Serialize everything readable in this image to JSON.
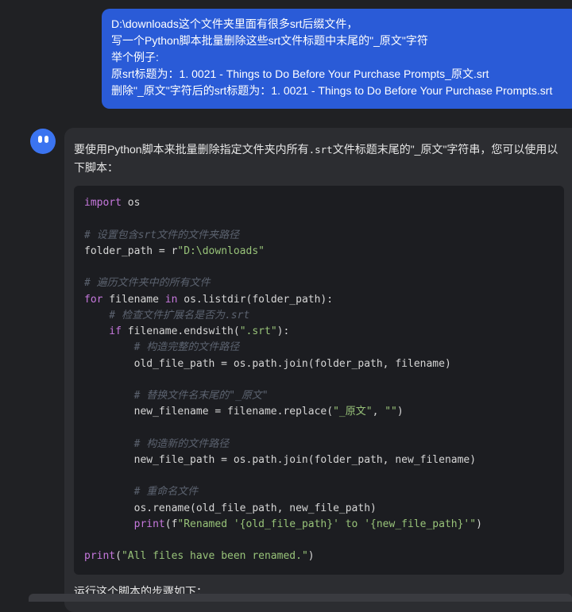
{
  "user_message": {
    "lines": [
      "D:\\downloads这个文件夹里面有很多srt后缀文件，",
      "写一个Python脚本批量删除这些srt文件标题中末尾的\"_原文\"字符",
      "举个例子:",
      "原srt标题为：1. 0021 - Things to Do Before Your Purchase Prompts_原文.srt",
      "删除\"_原文\"字符后的srt标题为：1. 0021 - Things to Do Before Your Purchase Prompts.srt"
    ]
  },
  "assistant": {
    "intro_before": "要使用Python脚本来批量删除指定文件夹内所有",
    "intro_code": ".srt",
    "intro_after": "文件标题末尾的\"_原文\"字符串，您可以使用以下脚本：",
    "code": {
      "l1_kw": "import",
      "l1_rest": " os",
      "c1": "# 设置包含srt文件的文件夹路径",
      "l2_a": "folder_path = r",
      "l2_str": "\"D:\\downloads\"",
      "c2": "# 遍历文件夹中的所有文件",
      "l3_kw1": "for",
      "l3_a": " filename ",
      "l3_kw2": "in",
      "l3_b": " os.listdir(folder_path):",
      "c3": "    # 检查文件扩展名是否为.srt",
      "l4_kw": "    if",
      "l4_a": " filename.endswith(",
      "l4_str": "\".srt\"",
      "l4_b": "):",
      "c4": "        # 构造完整的文件路径",
      "l5": "        old_file_path = os.path.join(folder_path, filename)",
      "c5": "        # 替换文件名末尾的\"_原文\"",
      "l6_a": "        new_filename = filename.replace(",
      "l6_str1": "\"_原文\"",
      "l6_b": ", ",
      "l6_str2": "\"\"",
      "l6_c": ")",
      "c6": "        # 构造新的文件路径",
      "l7": "        new_file_path = os.path.join(folder_path, new_filename)",
      "c7": "        # 重命名文件",
      "l8": "        os.rename(old_file_path, new_file_path)",
      "l9_fn": "        print",
      "l9_a": "(f",
      "l9_str": "\"Renamed '{old_file_path}' to '{new_file_path}'\"",
      "l9_b": ")",
      "l10_fn": "print",
      "l10_a": "(",
      "l10_str": "\"All files have been renamed.\"",
      "l10_b": ")"
    },
    "outro": "运行这个脚本的步骤如下："
  }
}
